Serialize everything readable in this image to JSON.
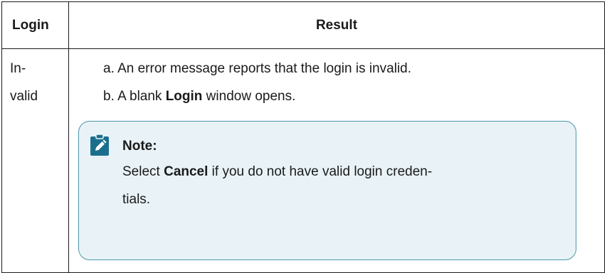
{
  "table": {
    "headers": {
      "login": "Login",
      "result": "Result"
    },
    "row": {
      "login_value_line1": "In-",
      "login_value_line2": "valid",
      "steps": [
        {
          "marker": "a.",
          "text": "An error message reports that the login is invalid."
        },
        {
          "marker": "b.",
          "prefix": "A blank ",
          "bold": "Login",
          "suffix": " window opens."
        }
      ]
    }
  },
  "note": {
    "icon": "pencil-clipboard-icon",
    "title": "Note:",
    "prefix": "Select ",
    "bold": "Cancel",
    "suffix_line1": " if you do not have valid login creden-",
    "suffix_line2": "tials."
  },
  "colors": {
    "note_background": "#e9f3f7",
    "note_border": "#4d97ac",
    "note_icon": "#1c6f8c"
  }
}
